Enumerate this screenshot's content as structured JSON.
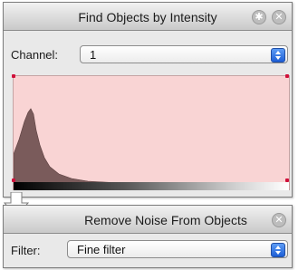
{
  "panel1": {
    "title": "Find Objects by Intensity",
    "gear_icon": "gear-icon",
    "close_icon": "close-icon",
    "channel_label": "Channel:",
    "channel_value": "1",
    "histogram": {
      "fill_color": "#7a5b5b",
      "background": "#f9d4d4"
    }
  },
  "panel2": {
    "title": "Remove Noise From Objects",
    "close_icon": "close-icon",
    "filter_label": "Filter:",
    "filter_value": "Fine filter"
  },
  "colors": {
    "accent": "#1e5fd6",
    "marker": "#d0103a"
  }
}
